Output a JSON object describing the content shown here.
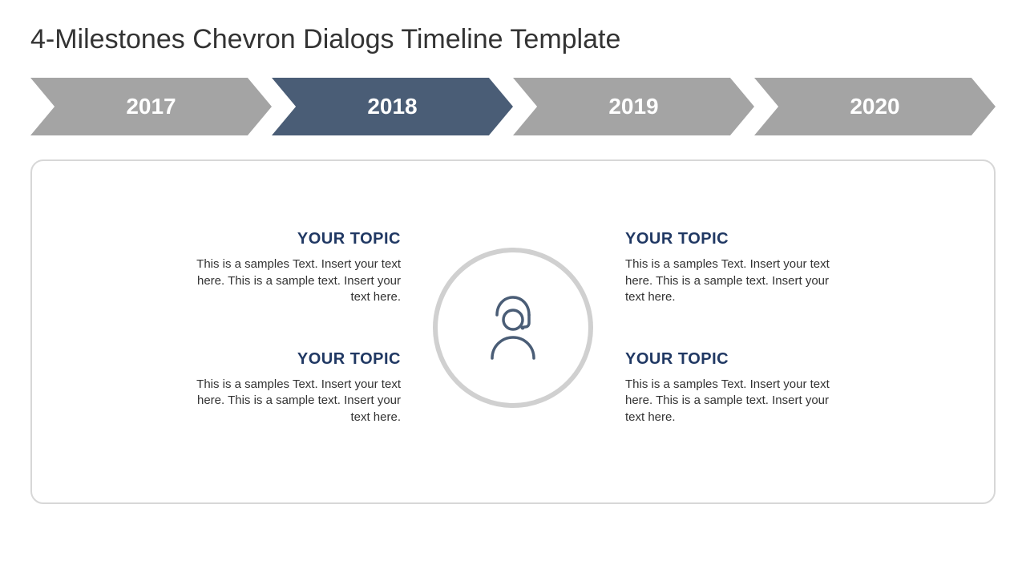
{
  "title": "4-Milestones Chevron Dialogs Timeline Template",
  "colors": {
    "inactive": "#a4a4a4",
    "active": "#4a5d76",
    "heading": "#203863"
  },
  "chevrons": [
    {
      "label": "2017",
      "active": false
    },
    {
      "label": "2018",
      "active": true
    },
    {
      "label": "2019",
      "active": false
    },
    {
      "label": "2020",
      "active": false
    }
  ],
  "topics": {
    "top_left": {
      "title": "YOUR TOPIC",
      "body": "This is a samples Text. Insert your text here. This is a sample text. Insert your text here."
    },
    "bottom_left": {
      "title": "YOUR TOPIC",
      "body": "This is a samples Text. Insert your text here. This is a sample text. Insert your text here."
    },
    "top_right": {
      "title": "YOUR TOPIC",
      "body": "This is a samples Text. Insert your text here. This is a sample text. Insert your text here."
    },
    "bottom_right": {
      "title": "YOUR TOPIC",
      "body": "This is a samples Text. Insert your text here. This is a sample text. Insert your text here."
    }
  },
  "center_icon": "headset-person-icon"
}
